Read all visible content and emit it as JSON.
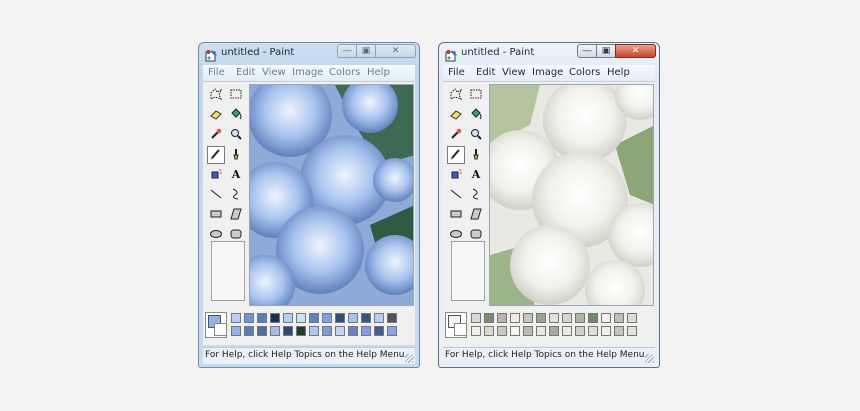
{
  "windows": [
    {
      "id": "left",
      "title": "untitled - Paint",
      "state": "inactive",
      "menu": [
        "File",
        "Edit",
        "View",
        "Image",
        "Colors",
        "Help"
      ],
      "status": "For Help, click Help Topics on the Help Menu.",
      "canvas_theme": "blue-hydrangeas",
      "foreground_color": "#8fb3ee",
      "palette_row1": [
        "#b7cdf3",
        "#6f93cf",
        "#5e7fae",
        "#16324f",
        "#b7cdf3",
        "#cfe0f7",
        "#5a86bf",
        "#7da3dc",
        "#2f4e74",
        "#a8c1ea",
        "#3b5578",
        "#b7cdf3",
        "#525252"
      ],
      "palette_row2": [
        "#93b4ea",
        "#5b7db3",
        "#4b6ea3",
        "#a4bde6",
        "#2b4a6d",
        "#1f3a30",
        "#b3c8ee",
        "#7d9bd6",
        "#c3d2f1",
        "#6681c8",
        "#8e97e6",
        "#3c5f9a",
        "#88a6e0"
      ]
    },
    {
      "id": "right",
      "title": "untitled - Paint",
      "state": "active",
      "menu": [
        "File",
        "Edit",
        "View",
        "Image",
        "Colors",
        "Help"
      ],
      "status": "For Help, click Help Topics on the Help Menu.",
      "canvas_theme": "white-hydrangeas",
      "foreground_color": "#f4f2ee",
      "palette_row1": [
        "#d9dbd2",
        "#7b8f6b",
        "#b5b8a8",
        "#ededea",
        "#c6c7bc",
        "#9aa38b",
        "#e1e2d6",
        "#d3d6c8",
        "#b1b4a2",
        "#6f8a5c",
        "#eeeeeb",
        "#bfc2b3",
        "#dcdcd4"
      ],
      "palette_row2": [
        "#eef0e8",
        "#d7d9cf",
        "#c8cabf",
        "#f4f4f0",
        "#b9bcac",
        "#e6e7de",
        "#a7ac98",
        "#e9ebdf",
        "#cfd1c5",
        "#ddded5",
        "#f0f0ec",
        "#c1c4b6",
        "#e2e3da"
      ]
    }
  ],
  "icons": {
    "app": "paint-app-icon",
    "tools": [
      "free-form-select-icon",
      "rect-select-icon",
      "eraser-icon",
      "fill-bucket-icon",
      "color-picker-icon",
      "magnifier-icon",
      "pencil-icon",
      "brush-icon",
      "airbrush-icon",
      "text-icon",
      "line-icon",
      "curve-icon",
      "rectangle-icon",
      "polygon-icon",
      "ellipse-icon",
      "rounded-rect-icon"
    ]
  }
}
